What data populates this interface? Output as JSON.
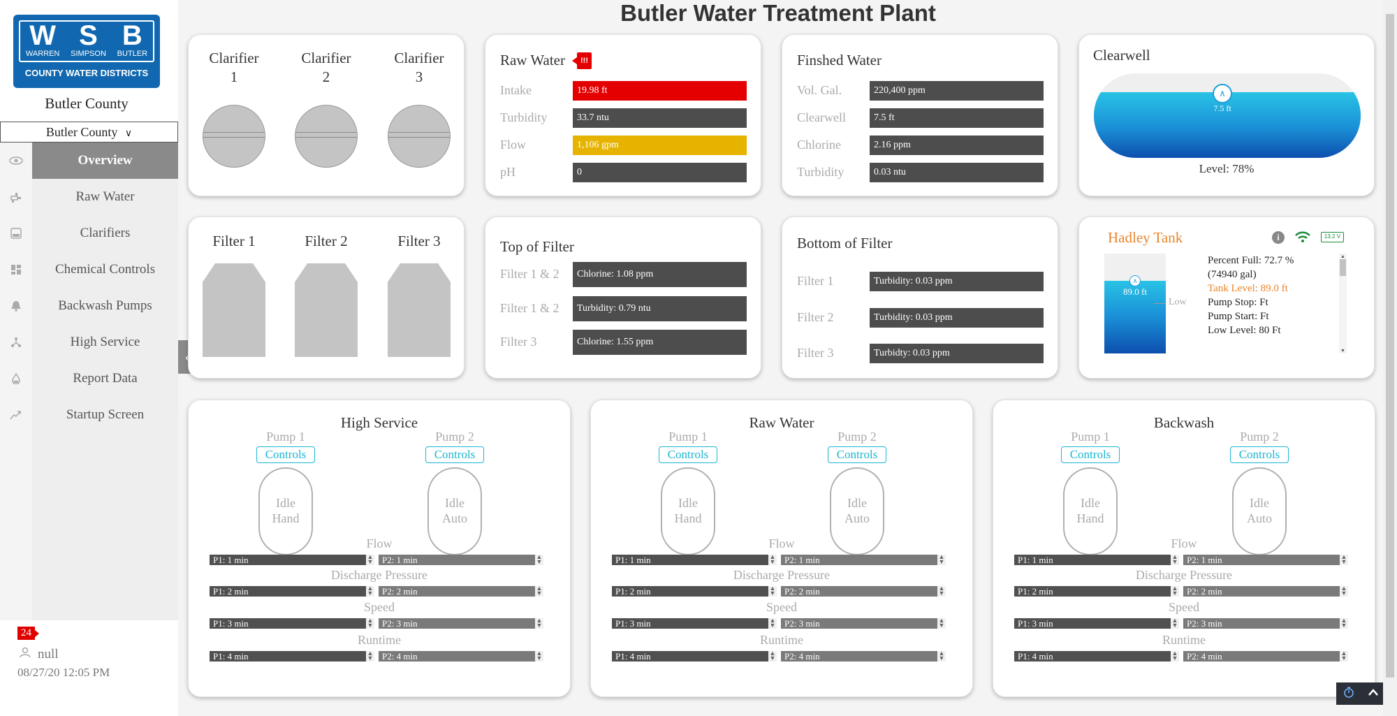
{
  "page": {
    "title": "Butler Water Treatment Plant"
  },
  "logo": {
    "letters": [
      "W",
      "S",
      "B"
    ],
    "names": [
      "WARREN",
      "SIMPSON",
      "BUTLER"
    ],
    "subtitle": "COUNTY WATER DISTRICTS"
  },
  "sidebar": {
    "county_label": "Butler County",
    "county_select": "Butler County",
    "items": [
      {
        "label": "Overview",
        "icon": "eye-icon",
        "active": true
      },
      {
        "label": "Raw Water",
        "icon": "faucet-icon"
      },
      {
        "label": "Clarifiers",
        "icon": "tank-icon"
      },
      {
        "label": "Chemical Controls",
        "icon": "dashboard-icon"
      },
      {
        "label": "Backwash Pumps",
        "icon": "bell-icon"
      },
      {
        "label": "High Service",
        "icon": "network-icon"
      },
      {
        "label": "Report Data",
        "icon": "droplet-icon"
      },
      {
        "label": "Startup Screen",
        "icon": "trend-icon"
      }
    ],
    "notification_count": "24",
    "user": "null",
    "timestamp": "08/27/20 12:05 PM"
  },
  "clarifiers": {
    "cols": [
      {
        "title": "Clarifier",
        "num": "1"
      },
      {
        "title": "Clarifier",
        "num": "2"
      },
      {
        "title": "Clarifier",
        "num": "3"
      }
    ]
  },
  "raw_water": {
    "title": "Raw Water",
    "alert": "!!!",
    "rows": [
      {
        "label": "Intake",
        "value": "19.98 ft"
      },
      {
        "label": "Turbidity",
        "value": "33.7 ntu"
      },
      {
        "label": "Flow",
        "value": "1,106 gpm"
      },
      {
        "label": "pH",
        "value": "0"
      }
    ]
  },
  "finished_water": {
    "title": "Finshed Water",
    "rows": [
      {
        "label": "Vol. Gal.",
        "value": "220,400 ppm"
      },
      {
        "label": "Clearwell",
        "value": "7.5 ft"
      },
      {
        "label": "Chlorine",
        "value": "2.16 ppm"
      },
      {
        "label": "Turbidity",
        "value": "0.03 ntu"
      }
    ]
  },
  "clearwell": {
    "title": "Clearwell",
    "level_marker": "7.5 ft",
    "level_text": "Level: 78%",
    "fill": 0.78
  },
  "filters": {
    "labels": [
      "Filter 1",
      "Filter 2",
      "Filter 3"
    ]
  },
  "top_filter": {
    "title": "Top of Filter",
    "rows": [
      {
        "label": "Filter 1 & 2",
        "value": "Chlorine: 1.08 ppm"
      },
      {
        "label": "Filter 1 & 2",
        "value": "Turbidity: 0.79 ntu"
      },
      {
        "label": "Filter 3",
        "value": "Chlorine: 1.55 ppm"
      }
    ]
  },
  "bottom_filter": {
    "title": "Bottom of Filter",
    "rows": [
      {
        "label": "Filter 1",
        "value": "Turbidity: 0.03 ppm"
      },
      {
        "label": "Filter 2",
        "value": "Turbidity: 0.03 ppm"
      },
      {
        "label": "Filter 3",
        "value": "Turbidty: 0.03 ppm"
      }
    ]
  },
  "hadley": {
    "title": "Hadley Tank",
    "battery": "13.2 V",
    "level_marker": "89.0 ft",
    "low_label": "Low",
    "fill": 0.727,
    "lines": [
      "Percent Full: 72.7 %",
      "(74940 gal)",
      "Tank Level: 89.0 ft",
      "Pump Stop: Ft",
      "Pump Start: Ft",
      "Low Level: 80 Ft"
    ]
  },
  "pumps": [
    {
      "title": "High Service",
      "p1": "Pump 1",
      "p2": "Pump 2",
      "controls": "Controls",
      "p1_state": [
        "Idle",
        "Hand"
      ],
      "p2_state": [
        "Idle",
        "Auto"
      ]
    },
    {
      "title": "Raw Water",
      "p1": "Pump 1",
      "p2": "Pump 2",
      "controls": "Controls",
      "p1_state": [
        "Idle",
        "Hand"
      ],
      "p2_state": [
        "Idle",
        "Auto"
      ]
    },
    {
      "title": "Backwash",
      "p1": "Pump 1",
      "p2": "Pump 2",
      "controls": "Controls",
      "p1_state": [
        "Idle",
        "Hand"
      ],
      "p2_state": [
        "Idle",
        "Auto"
      ]
    }
  ],
  "pump_sections": [
    {
      "label": "Flow",
      "p1": "P1: 1 min",
      "p2": "P2: 1 min"
    },
    {
      "label": "Discharge Pressure",
      "p1": "P1: 2 min",
      "p2": "P2: 2 min"
    },
    {
      "label": "Speed",
      "p1": "P1: 3 min",
      "p2": "P2: 3 min"
    },
    {
      "label": "Runtime",
      "p1": "P1: 4 min",
      "p2": "P2: 4 min"
    }
  ],
  "colors": {
    "accent": "#19b7d1",
    "alert": "#e40000",
    "warn": "#e6b400",
    "brand": "#1168b0",
    "orange": "#e8852b"
  }
}
